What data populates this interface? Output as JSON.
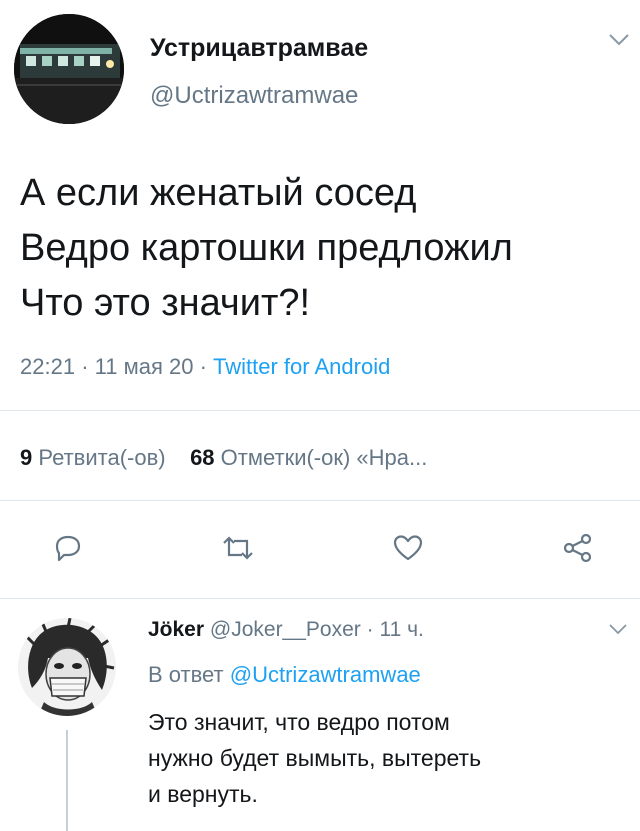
{
  "tweet": {
    "author_name": "Устрицавтрамвае",
    "author_handle": "@Uctrizawtramwae",
    "text_lines": [
      "А если женатый сосед",
      "Ведро картошки предложил",
      "Что это значит?!"
    ],
    "time": "22:21",
    "date": "11 мая 20",
    "source": "Twitter for Android"
  },
  "stats": {
    "retweets_count": "9",
    "retweets_label": "Ретвита(-ов)",
    "likes_count": "68",
    "likes_label": "Отметки(-ок) «Нра..."
  },
  "reply": {
    "author_name": "Jöker",
    "author_handle": "@Joker__Poxer",
    "age": "11 ч.",
    "reply_prefix": "В ответ",
    "reply_mention": "@Uctrizawtramwae",
    "text_lines": [
      "Это значит, что ведро потом",
      "нужно будет вымыть, вытереть",
      "и вернуть."
    ]
  },
  "icons": {
    "reply": "reply-icon",
    "retweet": "retweet-icon",
    "like": "heart-icon",
    "share": "share-icon",
    "more": "chevron-down-icon"
  },
  "colors": {
    "link": "#1da1f2",
    "secondary_text": "#657786",
    "primary_text": "#14171a",
    "divider": "#e1e8ed"
  }
}
